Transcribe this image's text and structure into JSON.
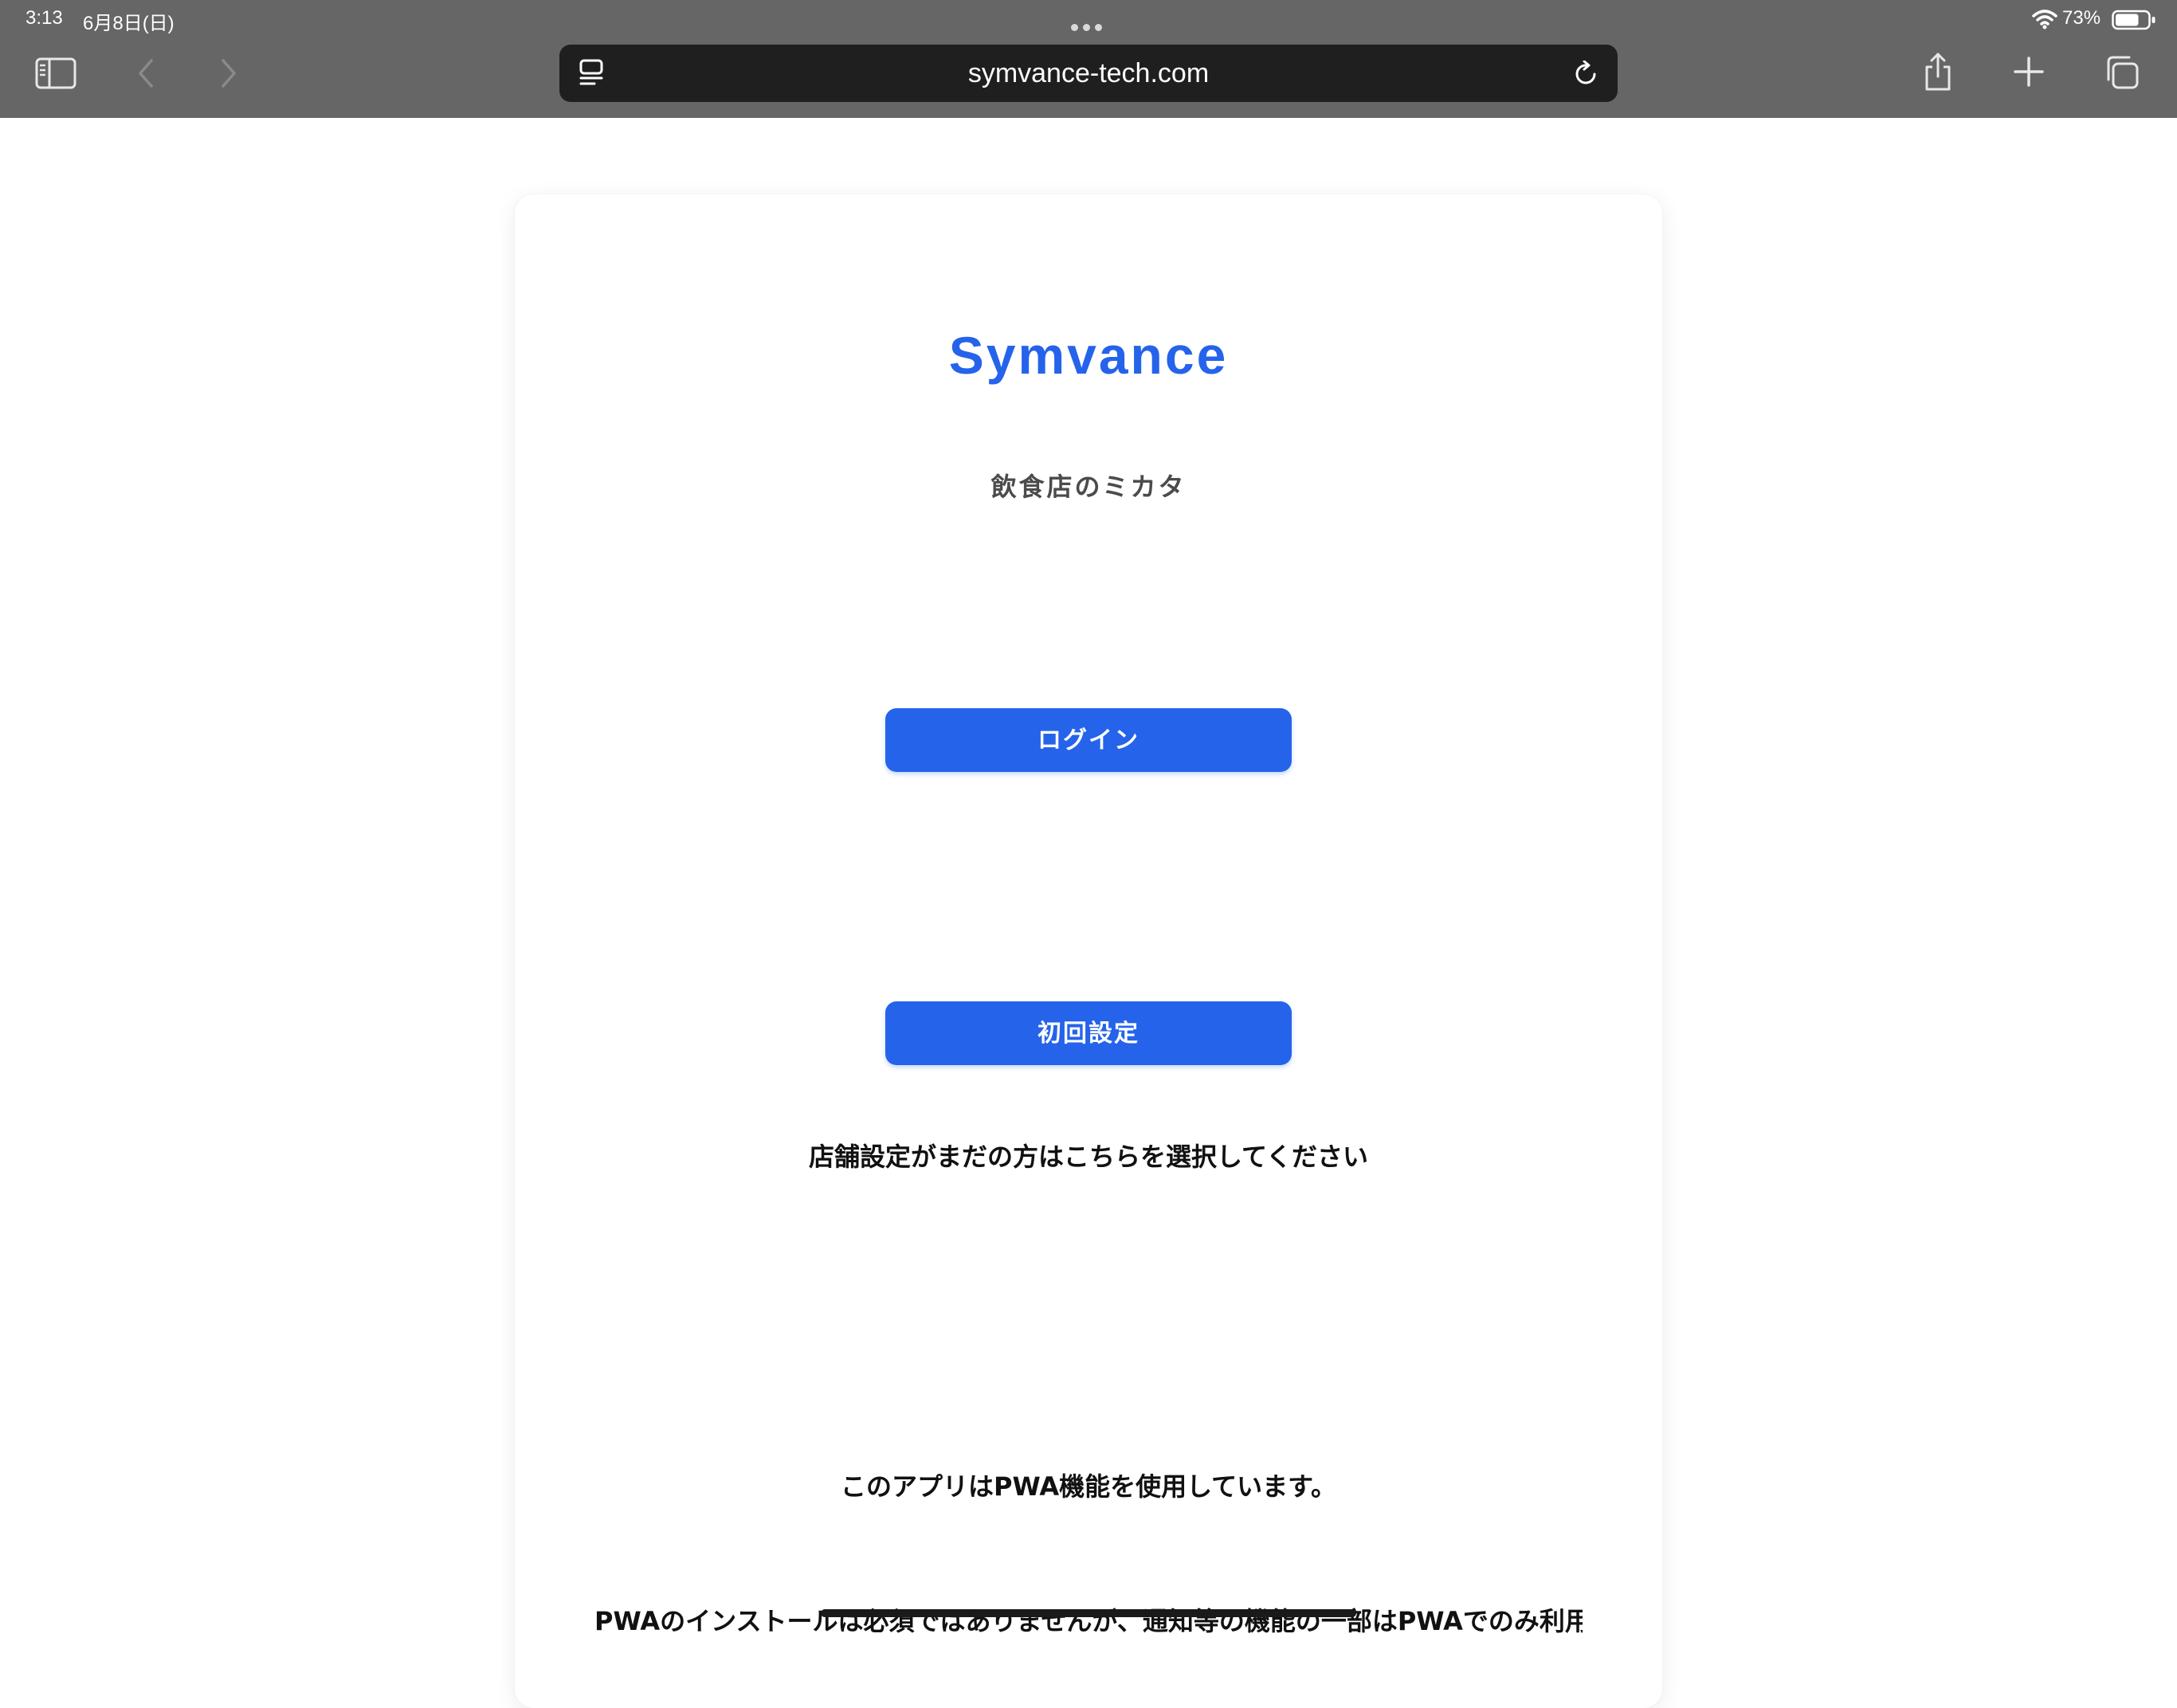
{
  "status_bar": {
    "time": "3:13",
    "date": "6月8日(日)",
    "battery_percent": "73%",
    "battery_level": 0.73
  },
  "toolbar": {
    "url": "symvance-tech.com"
  },
  "page": {
    "brand": "Symvance",
    "tagline": "飲食店のミカタ",
    "login_button": "ログイン",
    "setup_button": "初回設定",
    "setup_note": "店舗設定がまだの方はこちらを選択してください",
    "pwa_notice": "このアプリはPWA機能を使用しています。",
    "pwa_detail": "PWAのインストールは必須ではありませんが、通知等の機能の一部はPWAでのみ利用"
  },
  "colors": {
    "accent": "#2563eb",
    "browser_chrome": "#666666",
    "address_bar": "#1f1f1f"
  }
}
